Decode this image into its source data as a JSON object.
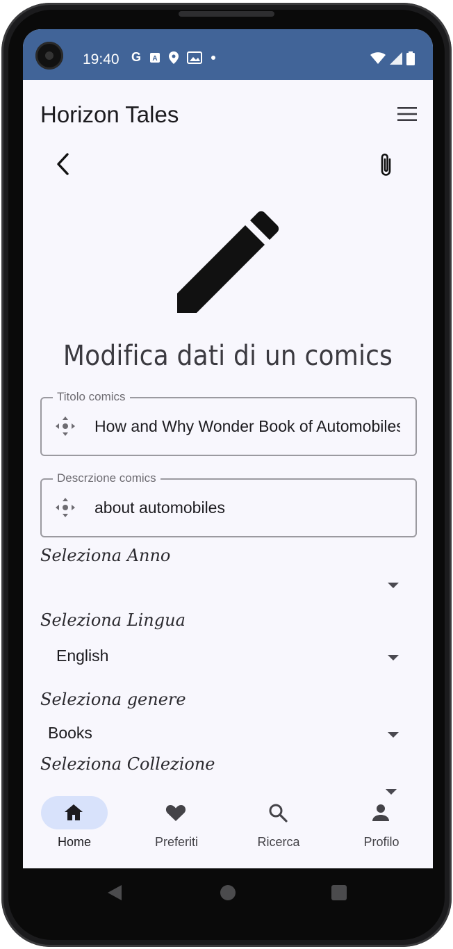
{
  "status_bar": {
    "time": "19:40",
    "icons": [
      "google-icon",
      "translate-icon",
      "location-icon",
      "gallery-icon",
      "dot-icon",
      "wifi-icon",
      "signal-icon",
      "battery-icon"
    ]
  },
  "app_bar": {
    "title": "Horizon Tales"
  },
  "page": {
    "heading": "Modifica dati di un comics"
  },
  "form": {
    "title_field": {
      "label": "Titolo comics",
      "value": "How and Why Wonder Book of Automobiles"
    },
    "description_field": {
      "label": "Descrzione comics",
      "value": "about automobiles"
    },
    "year": {
      "label": "Seleziona Anno",
      "value": ""
    },
    "language": {
      "label": "Seleziona Lingua",
      "value": "English"
    },
    "genre": {
      "label": "Seleziona genere",
      "value": "Books"
    },
    "collection": {
      "label": "Seleziona Collezione",
      "value": ""
    }
  },
  "bottom_nav": {
    "items": [
      {
        "label": "Home",
        "icon": "home-icon",
        "active": true
      },
      {
        "label": "Preferiti",
        "icon": "heart-icon",
        "active": false
      },
      {
        "label": "Ricerca",
        "icon": "search-icon",
        "active": false
      },
      {
        "label": "Profilo",
        "icon": "person-icon",
        "active": false
      }
    ]
  },
  "colors": {
    "status_bar": "#416498",
    "background": "#f8f7fd",
    "active_pill": "#d8e2fb"
  }
}
